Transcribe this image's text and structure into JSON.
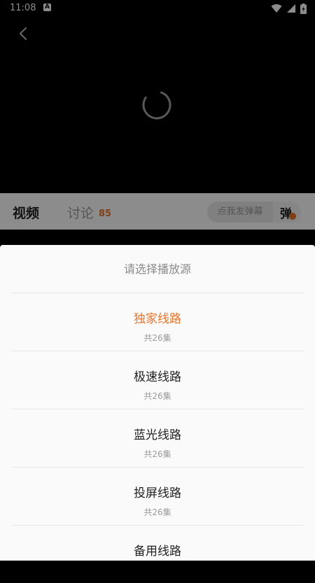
{
  "status_bar": {
    "time": "11:08",
    "notification_icon": "A"
  },
  "video": {
    "back_icon": "chevron-left-icon",
    "loading_icon": "spinner-icon"
  },
  "tabs": {
    "video_label": "视频",
    "discuss_label": "讨论",
    "discuss_count": "85",
    "danmu_placeholder": "点我发弹幕",
    "danmu_toggle_label": "弹"
  },
  "sheet": {
    "title": "请选择播放源",
    "options": [
      {
        "name": "独家线路",
        "count": "共26集",
        "selected": true
      },
      {
        "name": "极速线路",
        "count": "共26集",
        "selected": false
      },
      {
        "name": "蓝光线路",
        "count": "共26集",
        "selected": false
      },
      {
        "name": "投屏线路",
        "count": "共26集",
        "selected": false
      },
      {
        "name": "备用线路",
        "count": "",
        "selected": false
      }
    ]
  },
  "colors": {
    "accent": "#e8742b"
  }
}
